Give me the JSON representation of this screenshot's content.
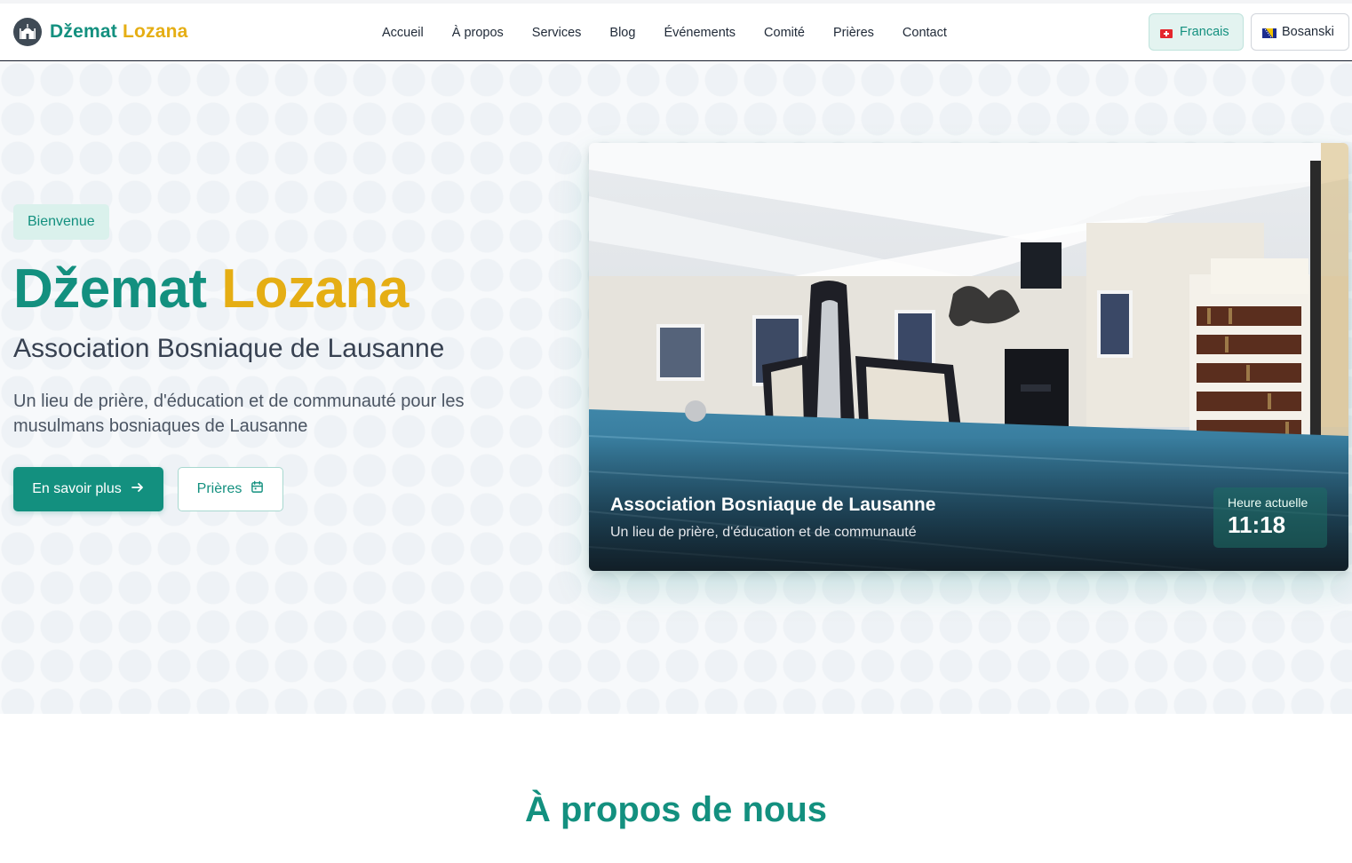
{
  "brand": {
    "name_part1": "Džemat",
    "name_part2": "Lozana"
  },
  "nav": {
    "items": [
      {
        "label": "Accueil"
      },
      {
        "label": "À propos"
      },
      {
        "label": "Services"
      },
      {
        "label": "Blog"
      },
      {
        "label": "Événements"
      },
      {
        "label": "Comité"
      },
      {
        "label": "Prières"
      },
      {
        "label": "Contact"
      }
    ]
  },
  "languages": {
    "french": {
      "label": "Francais",
      "flag": "swiss-flag-icon",
      "active": true
    },
    "bosnian": {
      "label": "Bosanski",
      "flag": "bosnian-flag-icon",
      "active": false
    }
  },
  "hero": {
    "badge": "Bienvenue",
    "title_part1": "Džemat",
    "title_part2": "Lozana",
    "subtitle": "Association Bosniaque de Lausanne",
    "description": "Un lieu de prière, d'éducation et de communauté pour les musulmans bosniaques de Lausanne",
    "primary_button": "En savoir plus",
    "secondary_button": "Prières"
  },
  "card": {
    "title": "Association Bosniaque de Lausanne",
    "subtitle": "Un lieu de prière, d'éducation et de communauté",
    "time_label": "Heure actuelle",
    "time_value": "11:18"
  },
  "about": {
    "title": "À propos de nous"
  },
  "colors": {
    "brand_teal": "#13907f",
    "brand_gold": "#e5ae14",
    "carpet_blue": "#2f6f94"
  }
}
